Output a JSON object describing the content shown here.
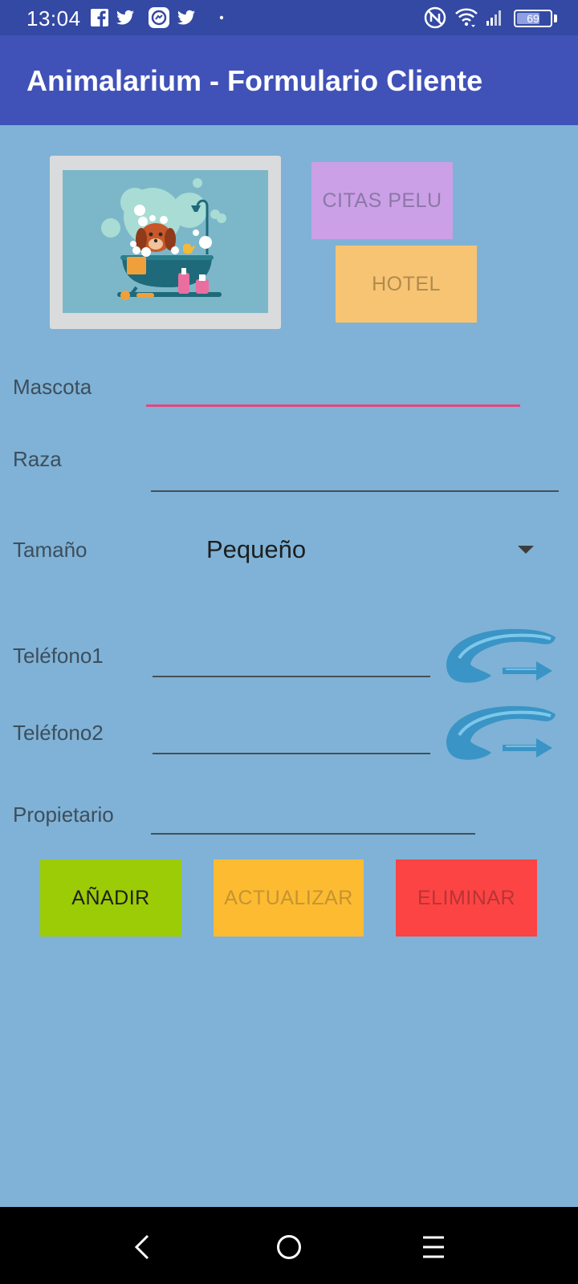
{
  "status_bar": {
    "time": "13:04",
    "battery_percent": "69",
    "battery_level": 0.69,
    "icons": [
      "facebook-icon",
      "twitter-icon",
      "messenger-icon",
      "twitter-icon",
      "dot-icon",
      "nfc-icon",
      "wifi-icon",
      "signal-icon",
      "battery-icon"
    ]
  },
  "app_bar": {
    "title": "Animalarium - Formulario Cliente",
    "color": "#4052b8"
  },
  "image": {
    "description_icon": "dog-bath-illustration"
  },
  "buttons": {
    "citas": "CITAS PELU",
    "hotel": "HOTEL",
    "add": "AÑADIR",
    "update": "ACTUALIZAR",
    "delete": "ELIMINAR"
  },
  "form": {
    "mascota_label": "Mascota",
    "mascota_value": "",
    "raza_label": "Raza",
    "raza_value": "",
    "tamano_label": "Tamaño",
    "tamano_selected": "Pequeño",
    "telefono1_label": "Teléfono1",
    "telefono1_value": "",
    "telefono2_label": "Teléfono2",
    "telefono2_value": "",
    "propietario_label": "Propietario",
    "propietario_value": ""
  },
  "colors": {
    "background": "#7fb2d6",
    "focus_underline": "#e2477f",
    "citas": "#cca0e6",
    "hotel": "#f7c473",
    "add": "#9bcc05",
    "update": "#fdbb32",
    "delete": "#fd4444"
  },
  "nav": {
    "icons": [
      "back-icon",
      "home-icon",
      "menu-icon"
    ]
  }
}
